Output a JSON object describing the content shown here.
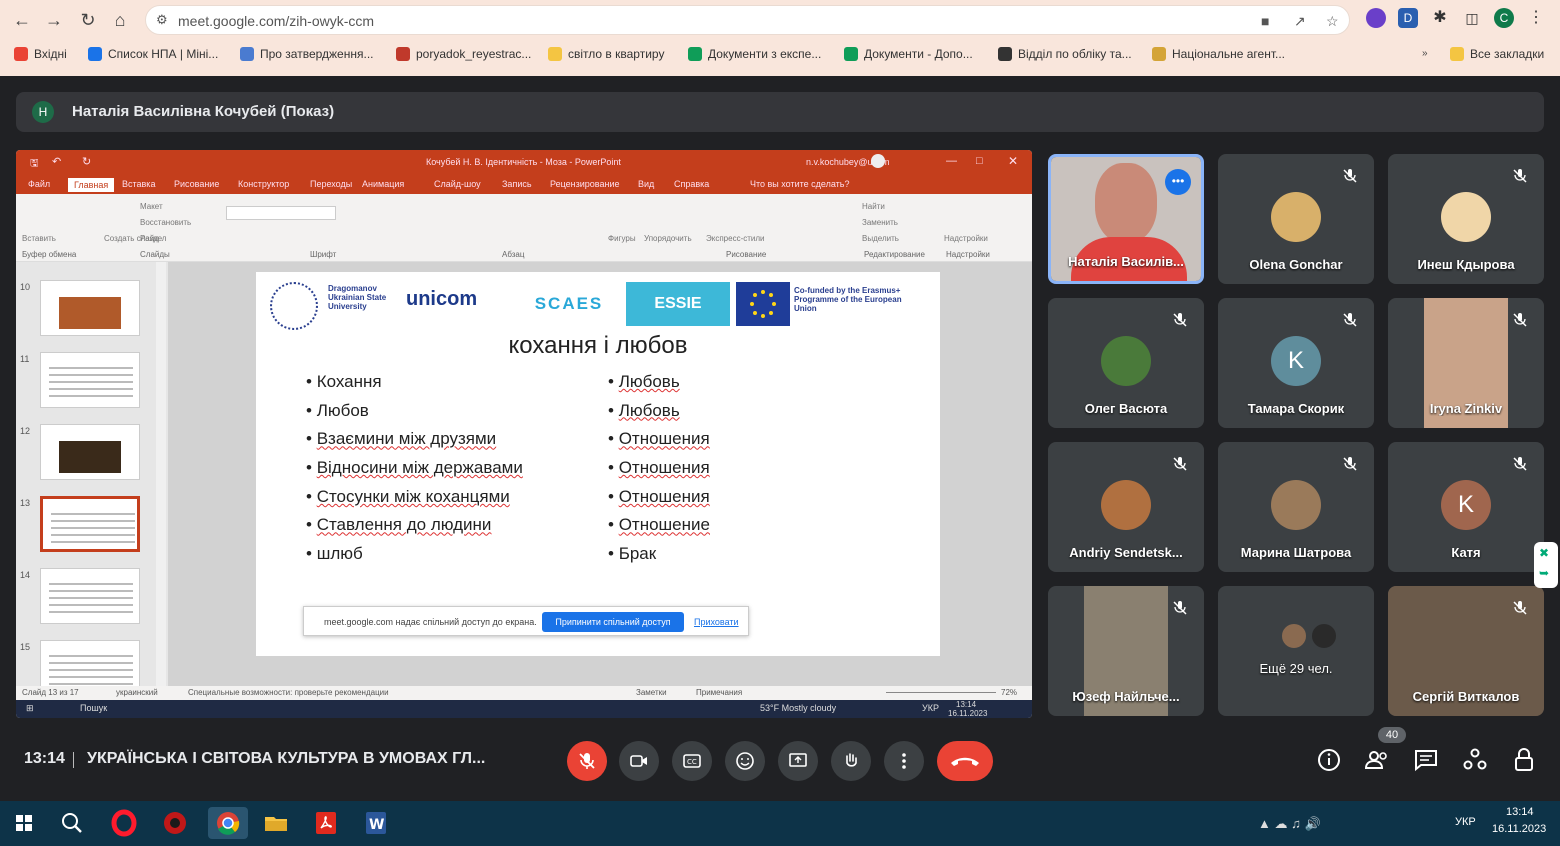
{
  "browser": {
    "url": "meet.google.com/zih-owyk-ccm",
    "profile_initial": "C",
    "bookmarks": [
      {
        "label": "Вхідні",
        "color": "#ea4335"
      },
      {
        "label": "Список НПА | Міні...",
        "color": "#1a73e8"
      },
      {
        "label": "Про затвердження...",
        "color": "#4a7bd0"
      },
      {
        "label": "poryadok_reyestrac...",
        "color": "#c0392b"
      },
      {
        "label": "світло в квартиру",
        "color": "#f4c542"
      },
      {
        "label": "Документи з експе...",
        "color": "#0f9d58"
      },
      {
        "label": "Документи - Допо...",
        "color": "#0f9d58"
      },
      {
        "label": "Відділ по обліку та...",
        "color": "#333333"
      },
      {
        "label": "Національне агент...",
        "color": "#d4a437"
      }
    ],
    "all_bookmarks": "Все закладки"
  },
  "presenter": {
    "initial": "Н",
    "name": "Наталія Василівна Кочубей (Показ)"
  },
  "powerpoint": {
    "title": "Кочубей Н. В. Ідентичність - Моза - PowerPoint",
    "account": "n.v.kochubey@uacm",
    "tabs": [
      "Файл",
      "Главная",
      "Вставка",
      "Рисование",
      "Конструктор",
      "Переходы",
      "Анимация",
      "Слайд-шоу",
      "Запись",
      "Рецензирование",
      "Вид",
      "Справка",
      "Что вы хотите сделать?"
    ],
    "ribbon_groups": [
      "Буфер обмена",
      "Слайды",
      "Шрифт",
      "Абзац",
      "Рисование",
      "Редактирование",
      "Надстройки"
    ],
    "ribbon_items": [
      "Вставить",
      "Создать слайд",
      "Макет",
      "Восстановить",
      "Раздел",
      "Фигуры",
      "Упорядочить",
      "Экспресс-стили",
      "Найти",
      "Заменить",
      "Выделить",
      "Надстройки"
    ],
    "thumb_numbers": [
      "10",
      "11",
      "12",
      "13",
      "14",
      "15"
    ],
    "slide": {
      "logos": [
        "Dragomanov Ukrainian State University",
        "unicom",
        "SCAES",
        "ESSIE",
        "Co-funded by the Erasmus+ Programme of the European Union"
      ],
      "title": "кохання і любов",
      "left_list": [
        "Кохання",
        "Любов",
        "Взаємини між друзями",
        "Відносини між державами",
        "Стосунки між коханцями",
        "Ставлення до людини",
        "шлюб"
      ],
      "right_list": [
        "Любовь",
        "Любовь",
        "Отношения",
        "Отношения",
        "Отношения",
        "Отношение",
        "Брак"
      ]
    },
    "share_notice": {
      "text": "meet.google.com надає спільний доступ до екрана.",
      "stop": "Припинити спільний доступ",
      "hide": "Приховати"
    },
    "status": {
      "slide": "Слайд 13 из 17",
      "lang": "украинский",
      "accessibility": "Специальные возможности: проверьте рекомендации",
      "notes": "Заметки",
      "comments": "Примечания",
      "zoom": "72%"
    },
    "inner_taskbar": {
      "search": "Пошук",
      "weather": "53°F  Mostly cloudy",
      "lang": "УКР",
      "time": "13:14",
      "date": "16.11.2023"
    }
  },
  "participants": [
    {
      "name": "Наталія Василів...",
      "type": "face",
      "color": "#c98a78",
      "speaking": true
    },
    {
      "name": "Olena Gonchar",
      "type": "face",
      "color": "#d8b06a",
      "muted": true
    },
    {
      "name": "Инеш Кдырова",
      "type": "face",
      "color": "#f0d6a8",
      "muted": true
    },
    {
      "name": "Олег Васюта",
      "type": "face",
      "color": "#4a7a3a",
      "muted": true
    },
    {
      "name": "Тамара Скорик",
      "type": "letter",
      "letter": "K",
      "color": "#5f8d9c",
      "muted": true
    },
    {
      "name": "Iryna Zinkiv",
      "type": "video",
      "color": "#c9a389",
      "muted": true
    },
    {
      "name": "Andriy Sendetsk...",
      "type": "face",
      "color": "#b07040",
      "muted": true
    },
    {
      "name": "Марина Шатрова",
      "type": "face",
      "color": "#9a7a5a",
      "muted": true
    },
    {
      "name": "Катя",
      "type": "letter",
      "letter": "K",
      "color": "#a0664e",
      "muted": true
    },
    {
      "name": "Юзеф Найльче...",
      "type": "video",
      "color": "#8a8070",
      "muted": true
    },
    {
      "name": "Ещё 29 чел.",
      "type": "more",
      "color": "#555555"
    },
    {
      "name": "Сергій Виткалов",
      "type": "video",
      "color": "#6b5a4a",
      "muted": true
    }
  ],
  "meeting": {
    "time": "13:14",
    "title": "УКРАЇНСЬКА І СВІТОВА КУЛЬТУРА В УМОВАХ ГЛ...",
    "participant_count": "40"
  },
  "taskbar": {
    "lang": "УКР",
    "time": "13:14",
    "date": "16.11.2023"
  },
  "colors": {
    "ppt_accent": "#c43e1c",
    "meet_bg": "#202124",
    "end_call": "#ea4335",
    "mic_off": "#ea4335"
  }
}
